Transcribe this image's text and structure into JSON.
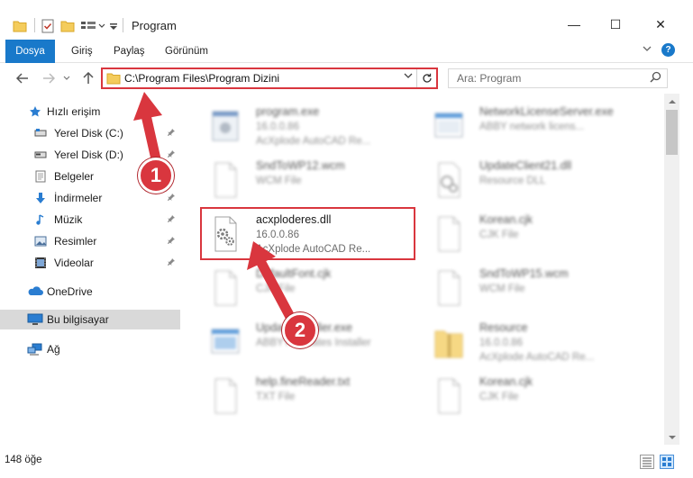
{
  "window": {
    "title": "Program",
    "controls": {
      "minimize": "—",
      "maximize": "☐",
      "close": "✕"
    }
  },
  "ribbon": {
    "tabs": [
      {
        "label": "Dosya",
        "active": true
      },
      {
        "label": "Giriş"
      },
      {
        "label": "Paylaş"
      },
      {
        "label": "Görünüm"
      }
    ],
    "help_glyph": "?"
  },
  "address": {
    "path": "C:\\Program Files\\Program Dizini",
    "highlight_color": "#d9363e"
  },
  "search": {
    "placeholder": "Ara: Program"
  },
  "nav": {
    "items": [
      {
        "label": "Hızlı erişim",
        "icon": "star-icon"
      },
      {
        "label": "Yerel Disk (C:)",
        "icon": "drive-icon",
        "pinned": true
      },
      {
        "label": "Yerel Disk (D:)",
        "icon": "drive-icon",
        "pinned": true
      },
      {
        "label": "Belgeler",
        "icon": "documents-icon",
        "pinned": true
      },
      {
        "label": "İndirmeler",
        "icon": "download-icon",
        "pinned": true
      },
      {
        "label": "Müzik",
        "icon": "music-icon",
        "pinned": true
      },
      {
        "label": "Resimler",
        "icon": "pictures-icon",
        "pinned": true
      },
      {
        "label": "Videolar",
        "icon": "videos-icon",
        "pinned": true
      },
      {
        "label": "OneDrive",
        "icon": "cloud-icon"
      },
      {
        "label": "Bu bilgisayar",
        "icon": "computer-icon",
        "selected": true
      },
      {
        "label": "Ağ",
        "icon": "network-icon"
      }
    ],
    "pin_glyph": "📌"
  },
  "files": [
    {
      "name": "program.exe",
      "line2": "16.0.0.86",
      "line3": "AcXplode AutoCAD Re...",
      "icon": "exe-icon",
      "blurred": true
    },
    {
      "name": "NetworkLicenseServer.exe",
      "line2": "ABBY network licens...",
      "line3": "",
      "icon": "app-icon",
      "blurred": true
    },
    {
      "name": "SndToWP12.wcm",
      "line2": "WCM File",
      "line3": "",
      "icon": "file-icon",
      "blurred": true
    },
    {
      "name": "UpdateClient21.dll",
      "line2": "Resource DLL",
      "line3": "",
      "icon": "dll-icon",
      "blurred": true
    },
    {
      "name": "acxploderes.dll",
      "line2": "16.0.0.86",
      "line3": "AcXplode AutoCAD Re...",
      "icon": "dll-gear-icon",
      "blurred": false
    },
    {
      "name": "Korean.cjk",
      "line2": "CJK File",
      "line3": "",
      "icon": "file-icon",
      "blurred": true
    },
    {
      "name": "DefaultFont.cjk",
      "line2": "CJK File",
      "line3": "",
      "icon": "file-icon",
      "blurred": true
    },
    {
      "name": "SndToWP15.wcm",
      "line2": "WCM File",
      "line3": "",
      "icon": "file-icon",
      "blurred": true
    },
    {
      "name": "UpdateInstaller.exe",
      "line2": "ABBYY Updates Installer",
      "line3": "",
      "icon": "installer-icon",
      "blurred": true
    },
    {
      "name": "Resource",
      "line2": "16.0.0.86",
      "line3": "AcXplode AutoCAD Re...",
      "icon": "archive-icon",
      "blurred": true
    },
    {
      "name": "help.fineReader.txt",
      "line2": "TXT File",
      "line3": "",
      "icon": "file-icon",
      "blurred": true
    },
    {
      "name": "Korean.cjk",
      "line2": "CJK File",
      "line3": "",
      "icon": "file-icon",
      "blurred": true
    }
  ],
  "status": {
    "count": "148 öğe"
  },
  "annotations": [
    {
      "number": "1",
      "color": "#d9363e"
    },
    {
      "number": "2",
      "color": "#d9363e"
    }
  ]
}
